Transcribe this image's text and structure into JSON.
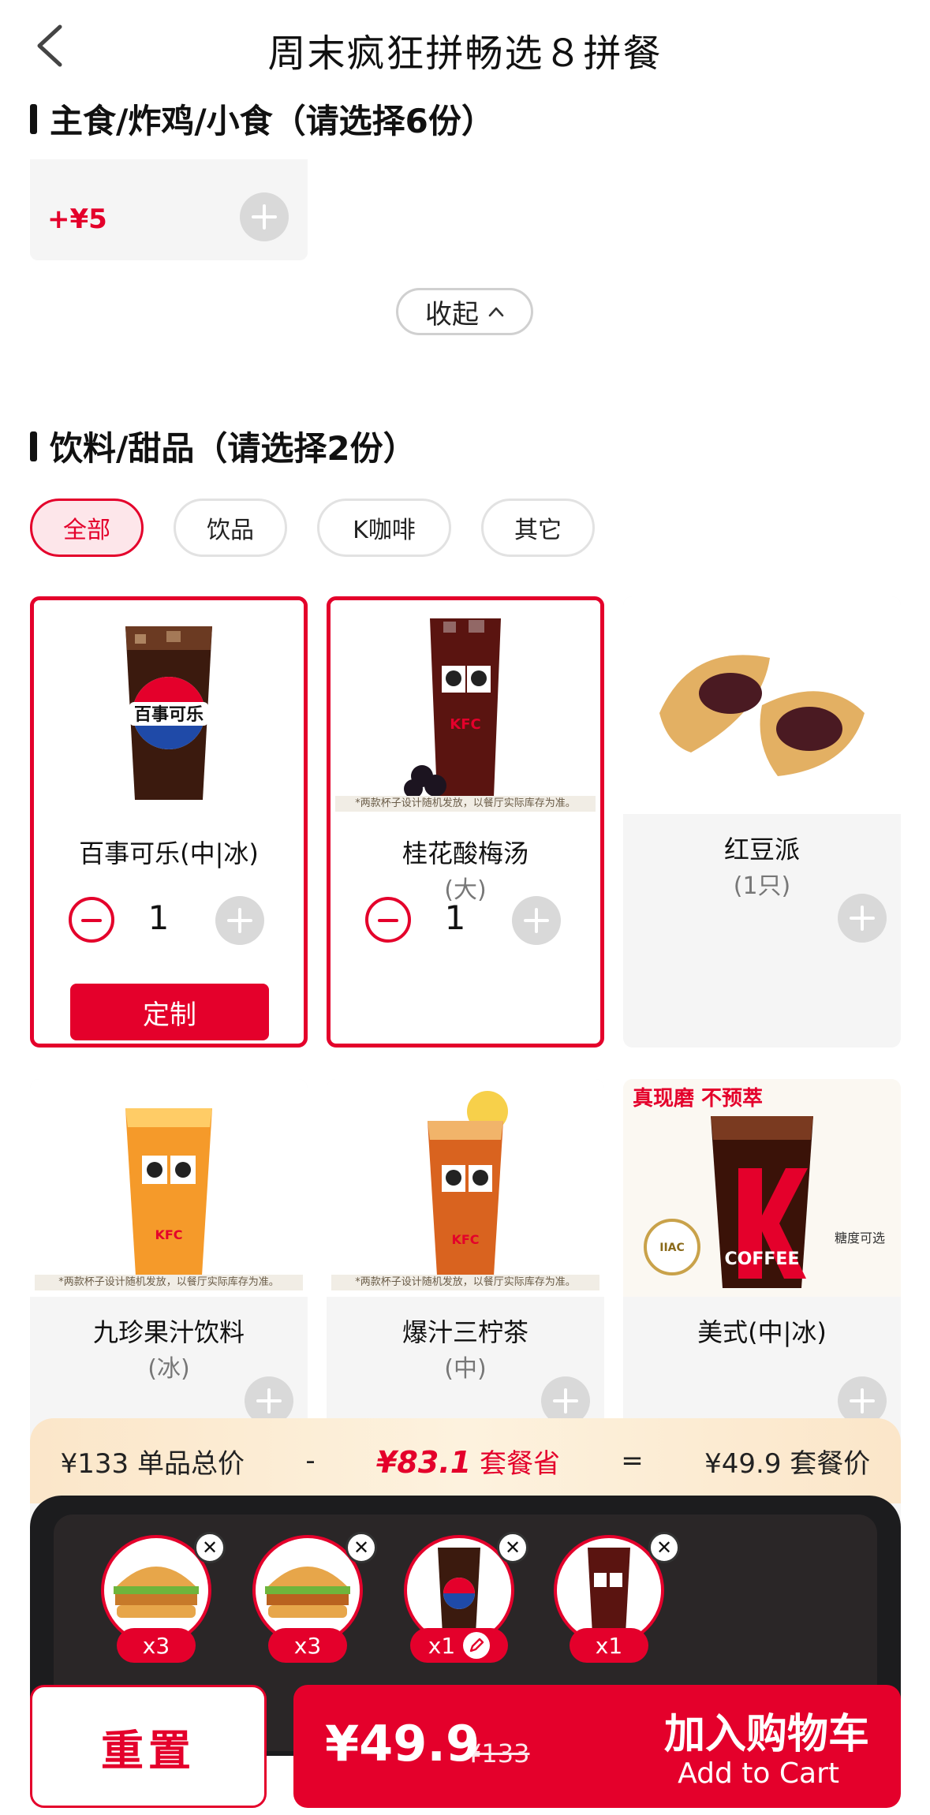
{
  "header": {
    "title": "周末疯狂拼畅选８拼餐"
  },
  "section_main": {
    "title": "主食/炸鸡/小食（请选择6份）",
    "partial_price": "+¥5",
    "collapse_label": "收起"
  },
  "section_drinks": {
    "title": "饮料/甜品（请选择2份）",
    "tabs": [
      "全部",
      "饮品",
      "K咖啡",
      "其它"
    ],
    "products": [
      {
        "name": "百事可乐(中|冰)",
        "spec": "",
        "qty": "1",
        "button": "定制",
        "badge": "百事可乐"
      },
      {
        "name": "桂花酸梅汤",
        "spec": "(大)",
        "qty": "1",
        "disclaimer": "*两款杯子设计随机发放，以餐厅实际库存为准。",
        "badge": "KFC"
      },
      {
        "name": "红豆派",
        "spec": "(1只)"
      },
      {
        "name": "九珍果汁饮料",
        "spec": "(冰)",
        "disclaimer": "*两款杯子设计随机发放，以餐厅实际库存为准。",
        "badge": "KFC"
      },
      {
        "name": "爆汁三柠茶",
        "spec": "(中)",
        "disclaimer": "*两款杯子设计随机发放，以餐厅实际库存为准。",
        "badge": "KFC"
      },
      {
        "name": "美式(中|冰)",
        "spec": "",
        "badge_top": "真现磨 不预萃",
        "badge_coffee": "COFFEE",
        "badge_medal": "IIAC",
        "badge_sugar": "糖度可选"
      }
    ]
  },
  "summary": {
    "total": "¥133 单品总价",
    "minus": "-",
    "saved_amount": "¥83.1",
    "saved_label": "套餐省",
    "equals": "=",
    "meal_price": "¥49.9 套餐价"
  },
  "tray": {
    "items": [
      {
        "count": "x3",
        "icon": "burger-icon"
      },
      {
        "count": "x3",
        "icon": "burger-icon"
      },
      {
        "count": "x1",
        "icon": "cola-cup-icon",
        "editable": true
      },
      {
        "count": "x1",
        "icon": "plum-drink-cup-icon"
      }
    ],
    "remove_glyph": "✕"
  },
  "bottom": {
    "reset_label": "重置",
    "cart_price": "¥49.9",
    "cart_original": "¥133",
    "cart_title": "加入购物车",
    "cart_subtitle": "Add to Cart"
  },
  "colors": {
    "accent": "#e4002b",
    "tray": "#1c1c1e",
    "summary_bg": "#fbe6c9"
  }
}
